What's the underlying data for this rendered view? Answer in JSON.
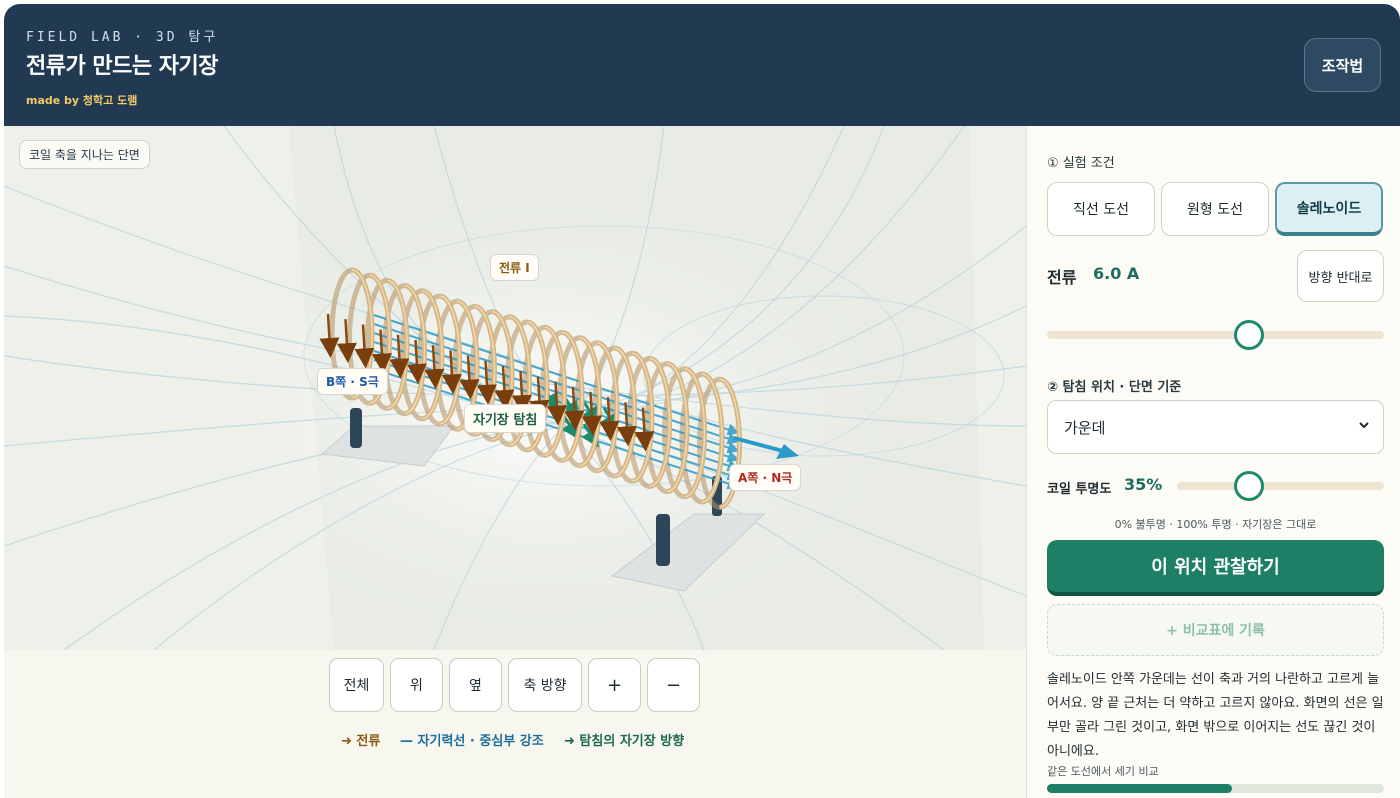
{
  "header": {
    "kicker": "FIELD LAB · 3D 탐구",
    "title": "전류가 만드는 자기장",
    "byline": "made by 청학고 도램",
    "help_label": "조작법"
  },
  "viewport": {
    "section_tag": "코일 축을 지나는 단면",
    "labels": {
      "current": "전류 I",
      "b_side": "B쪽 · S극",
      "probe": "자기장 탐침",
      "a_side": "A쪽 · N극"
    }
  },
  "view_controls": {
    "buttons": [
      "전체",
      "위",
      "옆",
      "축 방향",
      "+",
      "−"
    ]
  },
  "legend": {
    "current": "➜ 전류",
    "field_line": "— 자기력선 · 중심부 강조",
    "probe_direction": "➜ 탐침의 자기장 방향"
  },
  "panel": {
    "section1_title": "① 실험 조건",
    "conditions": [
      "직선 도선",
      "원형 도선",
      "솔레노이드"
    ],
    "active_condition": "솔레노이드",
    "current_label": "전류",
    "current_value": "6.0 A",
    "current_slider_fraction": 0.6,
    "reverse_label": "방향 반대로",
    "section2_title": "② 탐침 위치 · 단면 기준",
    "probe_position_selected": "가운데",
    "opacity_label": "코일 투명도",
    "opacity_value": "35%",
    "opacity_fraction": 0.35,
    "opacity_hint": "0% 불투명 · 100% 투명 · 자기장은 그대로",
    "observe_label": "이 위치 관찰하기",
    "record_label": "+ 비교표에 기록",
    "description": "솔레노이드 안쪽 가운데는 선이 축과 거의 나란하고 고르게 늘어서요. 양 끝 근처는 더 약하고 고르지 않아요. 화면의 선은 일부만 골라 그린 것이고, 화면 밖으로 이어지는 선도 끊긴 것이 아니에요.",
    "compare_label": "같은 도선에서 세기 비교",
    "compare_fraction": 0.55
  },
  "colors": {
    "header_bg": "#213a51",
    "accent_green": "#1c7f66",
    "coil": "#c9a472",
    "current_arrow": "#8a4a10",
    "field_line": "#2a9bc8",
    "probe_arrow": "#1f8a6a"
  }
}
